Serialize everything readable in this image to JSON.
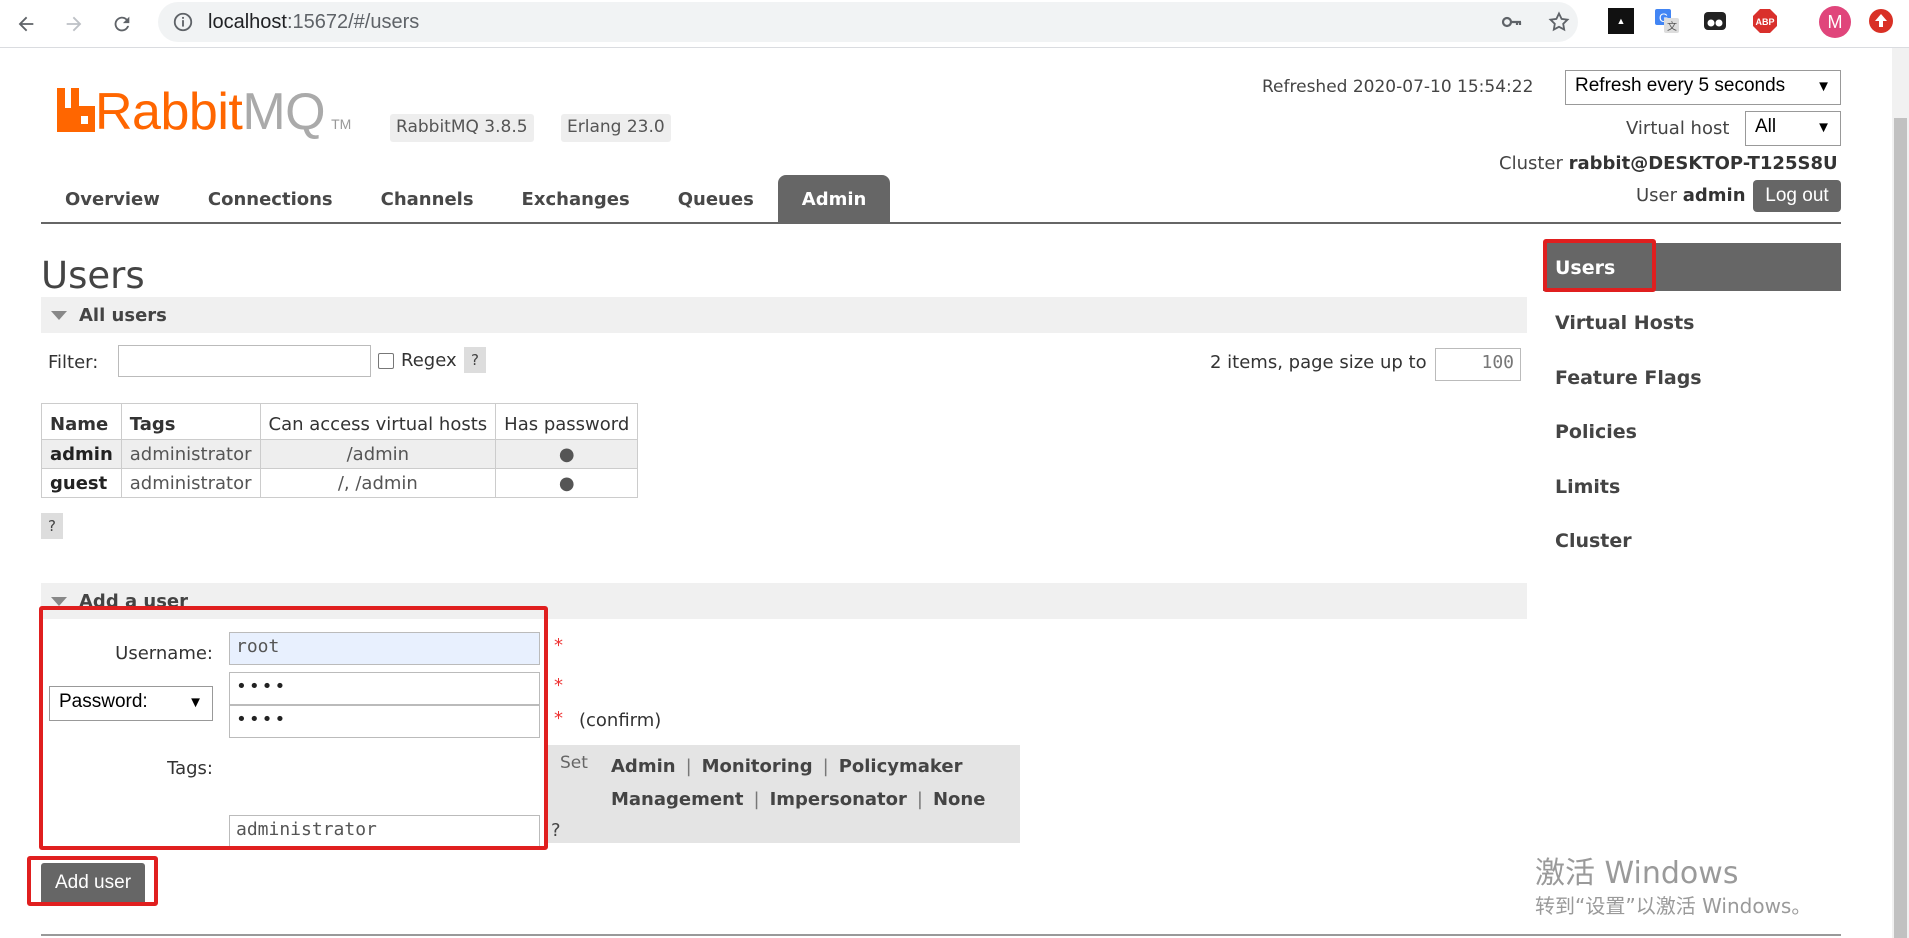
{
  "browser": {
    "url_host": "localhost",
    "url_rest": ":15672/#/users",
    "profile_initial": "M",
    "ext_abp": "ABP",
    "icons": [
      "back-icon",
      "forward-icon",
      "reload-icon",
      "site-info-icon",
      "key-icon",
      "star-icon",
      "translate-icon",
      "incognito-icon",
      "abp-icon",
      "profile-avatar",
      "update-icon"
    ]
  },
  "header": {
    "logo_rabbit": "Rabbit",
    "logo_mq": "MQ",
    "logo_tm": "TM",
    "version": "RabbitMQ 3.8.5",
    "erlang": "Erlang 23.0",
    "refreshed": "Refreshed 2020-07-10 15:54:22",
    "refresh_select": "Refresh every 5 seconds",
    "vhost_label": "Virtual host",
    "vhost_select": "All",
    "cluster_label": "Cluster",
    "cluster_name": "rabbit@DESKTOP-T125S8U",
    "user_label": "User",
    "user_name": "admin",
    "logout": "Log out"
  },
  "tabs": [
    "Overview",
    "Connections",
    "Channels",
    "Exchanges",
    "Queues",
    "Admin"
  ],
  "active_tab": "Admin",
  "right_nav": [
    "Users",
    "Virtual Hosts",
    "Feature Flags",
    "Policies",
    "Limits",
    "Cluster"
  ],
  "page_title": "Users",
  "all_users": {
    "section_title": "All users",
    "filter_label": "Filter:",
    "filter_value": "",
    "regex_label": "Regex",
    "help": "?",
    "items_label": "2 items, page size up to",
    "page_size": "100",
    "columns": [
      "Name",
      "Tags",
      "Can access virtual hosts",
      "Has password"
    ],
    "rows": [
      {
        "name": "admin",
        "tags": "administrator",
        "vhosts": "/admin",
        "has_password": "●"
      },
      {
        "name": "guest",
        "tags": "administrator",
        "vhosts": "/, /admin",
        "has_password": "●"
      }
    ]
  },
  "add_user": {
    "section_title": "Add a user",
    "username_label": "Username:",
    "username_value": "root",
    "password_mode": "Password:",
    "password_value": "••••",
    "confirm_value": "••••",
    "required": "*",
    "confirm_label": "(confirm)",
    "tags_label": "Tags:",
    "tags_value": "administrator",
    "set_label": "Set",
    "tag_links_row1": [
      "Admin",
      "Monitoring",
      "Policymaker"
    ],
    "tag_links_row2": [
      "Management",
      "Impersonator",
      "None"
    ],
    "separator": "|",
    "help": "?",
    "submit": "Add user"
  },
  "watermark": {
    "line1": "激活 Windows",
    "line2": "转到“设置”以激活 Windows。"
  },
  "colors": {
    "brand_orange": "#ff6600",
    "nav_active": "#666666",
    "highlight_red": "#e01f1f"
  }
}
